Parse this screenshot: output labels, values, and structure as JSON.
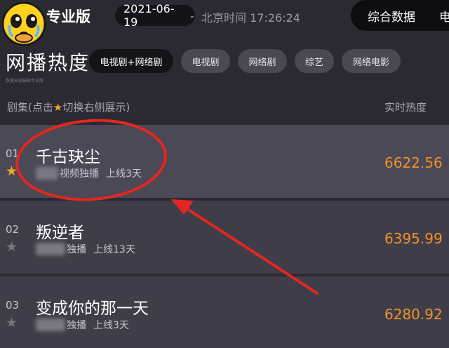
{
  "header": {
    "brand": "专业版",
    "date": "2021-06-19",
    "clock": "北京时间 17:26:24",
    "tabs": [
      "综合数据",
      "电"
    ]
  },
  "section": {
    "title": "网播热度",
    "note": "数据来源猫眼专业版",
    "chips": [
      "电视剧+网络剧",
      "电视剧",
      "网络剧",
      "综艺",
      "网络电影"
    ]
  },
  "list_header": {
    "left_prefix": "剧集(点击",
    "left_suffix": "切换右侧展示)",
    "right": "实时热度"
  },
  "rows": [
    {
      "rank": "01",
      "title": "千古玦尘",
      "sub_tag": "视频独播",
      "sub_days": "上线3天",
      "heat": "6622.56",
      "starred": true
    },
    {
      "rank": "02",
      "title": "叛逆者",
      "sub_tag": "独播",
      "sub_days": "上线13天",
      "heat": "6395.99",
      "starred": false
    },
    {
      "rank": "03",
      "title": "变成你的那一天",
      "sub_tag": "独播",
      "sub_days": "上线3天",
      "heat": "6280.92",
      "starred": false
    }
  ],
  "colors": {
    "background": "#2b2a33",
    "heat": "#f0922b",
    "star_active": "#f5a623",
    "annotation": "#e52620"
  },
  "icons": [
    "crying-emoji-icon",
    "chevron-down-icon",
    "star-icon"
  ]
}
